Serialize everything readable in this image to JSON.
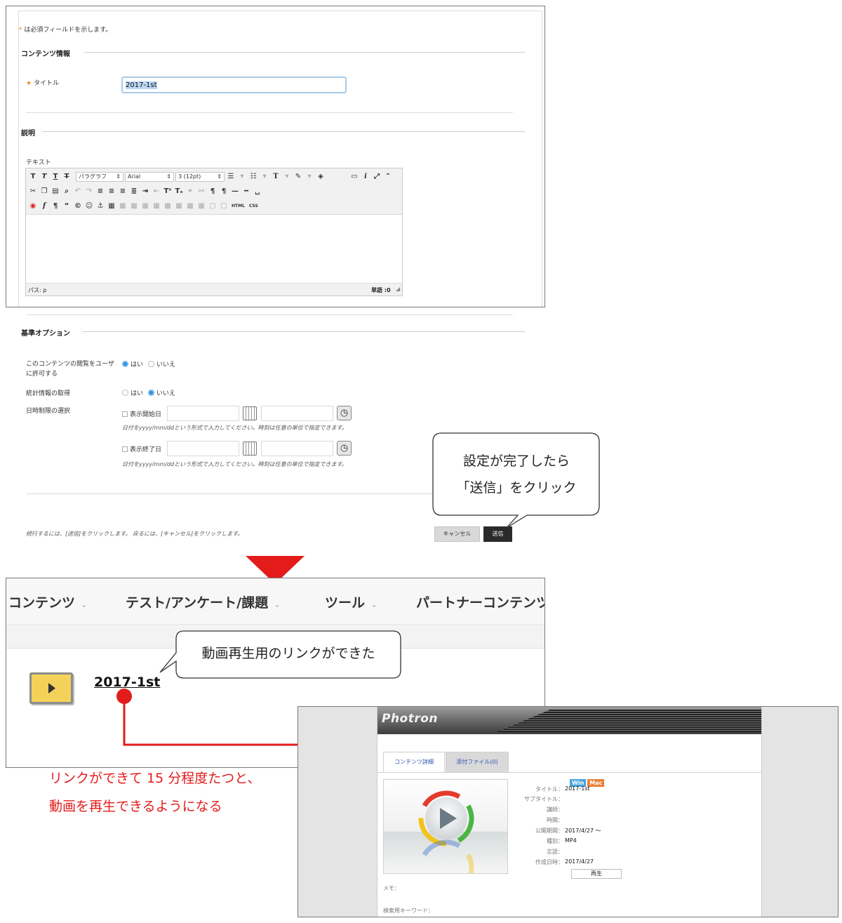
{
  "form": {
    "required_note": "は必須フィールドを示します。",
    "required_star": "*",
    "section_content": "コンテンツ情報",
    "title_label": "タイトル",
    "title_star": "★",
    "title_value": "2017-1st",
    "section_description": "説明",
    "text_label": "テキスト",
    "editor": {
      "format_select": "パラグラフ",
      "font_select": "Arial",
      "size_select": "3 (12pt)",
      "path_label": "パス: p",
      "word_count": "単語 :0",
      "html_label": "HTML",
      "css_label": "CSS"
    },
    "section_options": "基準オプション",
    "permit_label_1": "このコンテンツの閲覧をユーザ",
    "permit_label_2": "に許可する",
    "yes": "はい",
    "no": "いいえ",
    "stats_label": "統計情報の取得",
    "date_limit_label": "日時制限の選択",
    "display_start": "表示開始日",
    "display_end": "表示終了日",
    "date_hint": "日付をyyyy/mm/ddという形式で入力してください。時刻は任意の単位で指定できます。",
    "footer_note": "続行するには、[送信]をクリックします。 戻るには、[キャンセル]をクリックします。",
    "cancel_button": "キャンセル",
    "submit_button": "送信"
  },
  "callouts": {
    "submit_line1": "設定が完了したら",
    "submit_line2": "「送信」をクリック",
    "link_created": "動画再生用のリンクができた",
    "red_note_line1": "リンクができて 15 分程度たつと、",
    "red_note_line2": "動画を再生できるようになる"
  },
  "course": {
    "nav": [
      "コンテンツ",
      "テスト/アンケート/課題",
      "ツール",
      "パートナーコンテンツ"
    ],
    "item_title": "2017-1st"
  },
  "photron": {
    "logo": "Photron",
    "tabs": [
      "コンテンツ詳細",
      "添付ファイル(0)"
    ],
    "badge_win": "Win",
    "badge_mac": "Mac",
    "meta": [
      {
        "label": "タイトル：",
        "value": "2017-1st"
      },
      {
        "label": "サブタイトル：",
        "value": ""
      },
      {
        "label": "講師：",
        "value": ""
      },
      {
        "label": "時間：",
        "value": ""
      },
      {
        "label": "公開期間：",
        "value": "2017/4/27 〜"
      },
      {
        "label": "種別：",
        "value": "MP4"
      },
      {
        "label": "言語：",
        "value": ""
      },
      {
        "label": "作成日時：",
        "value": "2017/4/27"
      }
    ],
    "play_button": "再生",
    "memo_label": "メモ：",
    "keyword_label": "検索用キーワード："
  },
  "colors": {
    "accent_red": "#e31b1b",
    "star_orange": "#e48a1f",
    "radio_blue": "#2e90d8",
    "win_badge": "#4aa3df",
    "mac_badge": "#e8813a"
  }
}
